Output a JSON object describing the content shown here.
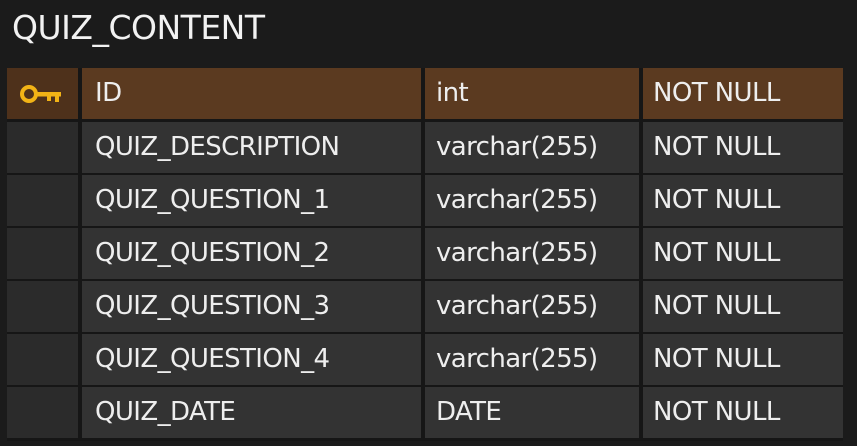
{
  "table": {
    "title": "QUIZ_CONTENT",
    "rows": [
      {
        "name": "ID",
        "type": "int",
        "constraint": "NOT NULL",
        "primary_key": true
      },
      {
        "name": "QUIZ_DESCRIPTION",
        "type": "varchar(255)",
        "constraint": "NOT NULL",
        "primary_key": false
      },
      {
        "name": "QUIZ_QUESTION_1",
        "type": "varchar(255)",
        "constraint": "NOT NULL",
        "primary_key": false
      },
      {
        "name": "QUIZ_QUESTION_2",
        "type": "varchar(255)",
        "constraint": "NOT NULL",
        "primary_key": false
      },
      {
        "name": "QUIZ_QUESTION_3",
        "type": "varchar(255)",
        "constraint": "NOT NULL",
        "primary_key": false
      },
      {
        "name": "QUIZ_QUESTION_4",
        "type": "varchar(255)",
        "constraint": "NOT NULL",
        "primary_key": false
      },
      {
        "name": "QUIZ_DATE",
        "type": "DATE",
        "constraint": "NOT NULL",
        "primary_key": false
      }
    ]
  },
  "icons": {
    "primary_key": "key-icon"
  },
  "colors": {
    "background": "#1b1b1b",
    "row": "#333333",
    "primary_row": "#5b3a20",
    "key_icon": "#f2b316",
    "text": "#eeeeee"
  }
}
